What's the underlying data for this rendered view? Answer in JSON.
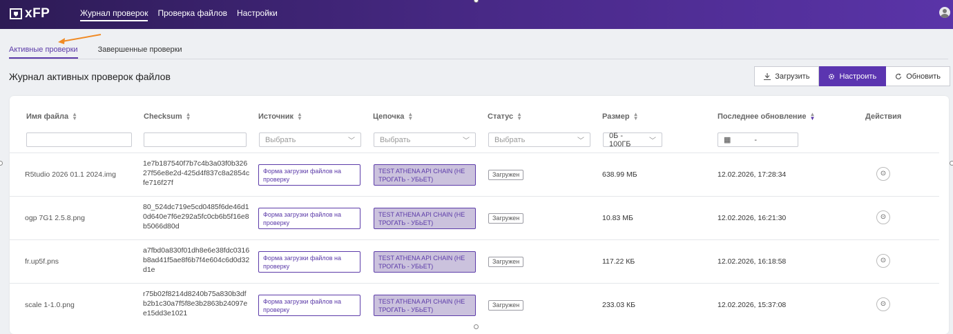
{
  "app": {
    "logo_text": "xFP"
  },
  "topnav": [
    {
      "label": "Журнал проверок",
      "active": true
    },
    {
      "label": "Проверка файлов",
      "active": false
    },
    {
      "label": "Настройки",
      "active": false
    }
  ],
  "subtabs": [
    {
      "label": "Активные проверки",
      "active": true
    },
    {
      "label": "Завершенные проверки",
      "active": false
    }
  ],
  "page_title": "Журнал активных проверок файлов",
  "toolbar": {
    "upload_label": "Загрузить",
    "configure_label": "Настроить",
    "refresh_label": "Обновить"
  },
  "columns": {
    "filename": "Имя файла",
    "checksum": "Checksum",
    "source": "Источник",
    "chain": "Цепочка",
    "status": "Статус",
    "size": "Размер",
    "updated": "Последнее обновление",
    "actions": "Действия"
  },
  "filters": {
    "source_placeholder": "Выбрать",
    "chain_placeholder": "Выбрать",
    "status_placeholder": "Выбрать",
    "size_range": "0Б - 100ГБ",
    "date_range": "-"
  },
  "rows": [
    {
      "filename": "R5tudio 2026 01.1 2024.img",
      "checksum": "1e7b187540f7b7c4b3a03f0b32627f56e8e2d-425d4f837c8a2854cfe716f27f",
      "source": "Форма загрузки файлов на проверку",
      "chain": "TEST ATHENA API CHAIN (НЕ ТРОГАТЬ - УБЬЕТ)",
      "status": "Загружен",
      "size": "638.99 МБ",
      "updated": "12.02.2026, 17:28:34"
    },
    {
      "filename": "ogp 7G1 2.5.8.png",
      "checksum": "80_524dc719e5cd0485f6de46d10d640e7f6e292a5fc0cb6b5f16e8b5066d80d",
      "source": "Форма загрузки файлов на проверку",
      "chain": "TEST ATHENA API CHAIN (НЕ ТРОГАТЬ - УБЬЕТ)",
      "status": "Загружен",
      "size": "10.83 МБ",
      "updated": "12.02.2026, 16:21:30"
    },
    {
      "filename": "fr.up5f.pns",
      "checksum": "a7fbd0a830f01dh8e6e38fdc0316b8ad41f5ae8f6b7f4e604c6d0d32d1e",
      "source": "Форма загрузки файлов на проверку",
      "chain": "TEST ATHENA API CHAIN (НЕ ТРОГАТЬ - УБЬЕТ)",
      "status": "Загружен",
      "size": "117.22 КБ",
      "updated": "12.02.2026, 16:18:58"
    },
    {
      "filename": "scale 1-1.0.png",
      "checksum": "r75b02f8214d8240b75a830b3dfb2b1c30a7f5f8e3b2863b24097ee15dd3e1021",
      "source": "Форма загрузки файлов на проверку",
      "chain": "TEST ATHENA API CHAIN (НЕ ТРОГАТЬ - УБЬЕТ)",
      "status": "Загружен",
      "size": "233.03 КБ",
      "updated": "12.02.2026, 15:37:08"
    }
  ]
}
